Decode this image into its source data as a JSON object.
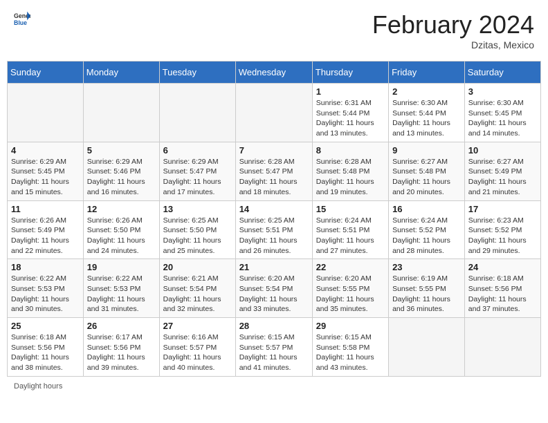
{
  "header": {
    "logo_general": "General",
    "logo_blue": "Blue",
    "month_title": "February 2024",
    "subtitle": "Dzitas, Mexico"
  },
  "days_of_week": [
    "Sunday",
    "Monday",
    "Tuesday",
    "Wednesday",
    "Thursday",
    "Friday",
    "Saturday"
  ],
  "weeks": [
    [
      {
        "day": "",
        "info": ""
      },
      {
        "day": "",
        "info": ""
      },
      {
        "day": "",
        "info": ""
      },
      {
        "day": "",
        "info": ""
      },
      {
        "day": "1",
        "info": "Sunrise: 6:31 AM\nSunset: 5:44 PM\nDaylight: 11 hours and 13 minutes."
      },
      {
        "day": "2",
        "info": "Sunrise: 6:30 AM\nSunset: 5:44 PM\nDaylight: 11 hours and 13 minutes."
      },
      {
        "day": "3",
        "info": "Sunrise: 6:30 AM\nSunset: 5:45 PM\nDaylight: 11 hours and 14 minutes."
      }
    ],
    [
      {
        "day": "4",
        "info": "Sunrise: 6:29 AM\nSunset: 5:45 PM\nDaylight: 11 hours and 15 minutes."
      },
      {
        "day": "5",
        "info": "Sunrise: 6:29 AM\nSunset: 5:46 PM\nDaylight: 11 hours and 16 minutes."
      },
      {
        "day": "6",
        "info": "Sunrise: 6:29 AM\nSunset: 5:47 PM\nDaylight: 11 hours and 17 minutes."
      },
      {
        "day": "7",
        "info": "Sunrise: 6:28 AM\nSunset: 5:47 PM\nDaylight: 11 hours and 18 minutes."
      },
      {
        "day": "8",
        "info": "Sunrise: 6:28 AM\nSunset: 5:48 PM\nDaylight: 11 hours and 19 minutes."
      },
      {
        "day": "9",
        "info": "Sunrise: 6:27 AM\nSunset: 5:48 PM\nDaylight: 11 hours and 20 minutes."
      },
      {
        "day": "10",
        "info": "Sunrise: 6:27 AM\nSunset: 5:49 PM\nDaylight: 11 hours and 21 minutes."
      }
    ],
    [
      {
        "day": "11",
        "info": "Sunrise: 6:26 AM\nSunset: 5:49 PM\nDaylight: 11 hours and 22 minutes."
      },
      {
        "day": "12",
        "info": "Sunrise: 6:26 AM\nSunset: 5:50 PM\nDaylight: 11 hours and 24 minutes."
      },
      {
        "day": "13",
        "info": "Sunrise: 6:25 AM\nSunset: 5:50 PM\nDaylight: 11 hours and 25 minutes."
      },
      {
        "day": "14",
        "info": "Sunrise: 6:25 AM\nSunset: 5:51 PM\nDaylight: 11 hours and 26 minutes."
      },
      {
        "day": "15",
        "info": "Sunrise: 6:24 AM\nSunset: 5:51 PM\nDaylight: 11 hours and 27 minutes."
      },
      {
        "day": "16",
        "info": "Sunrise: 6:24 AM\nSunset: 5:52 PM\nDaylight: 11 hours and 28 minutes."
      },
      {
        "day": "17",
        "info": "Sunrise: 6:23 AM\nSunset: 5:52 PM\nDaylight: 11 hours and 29 minutes."
      }
    ],
    [
      {
        "day": "18",
        "info": "Sunrise: 6:22 AM\nSunset: 5:53 PM\nDaylight: 11 hours and 30 minutes."
      },
      {
        "day": "19",
        "info": "Sunrise: 6:22 AM\nSunset: 5:53 PM\nDaylight: 11 hours and 31 minutes."
      },
      {
        "day": "20",
        "info": "Sunrise: 6:21 AM\nSunset: 5:54 PM\nDaylight: 11 hours and 32 minutes."
      },
      {
        "day": "21",
        "info": "Sunrise: 6:20 AM\nSunset: 5:54 PM\nDaylight: 11 hours and 33 minutes."
      },
      {
        "day": "22",
        "info": "Sunrise: 6:20 AM\nSunset: 5:55 PM\nDaylight: 11 hours and 35 minutes."
      },
      {
        "day": "23",
        "info": "Sunrise: 6:19 AM\nSunset: 5:55 PM\nDaylight: 11 hours and 36 minutes."
      },
      {
        "day": "24",
        "info": "Sunrise: 6:18 AM\nSunset: 5:56 PM\nDaylight: 11 hours and 37 minutes."
      }
    ],
    [
      {
        "day": "25",
        "info": "Sunrise: 6:18 AM\nSunset: 5:56 PM\nDaylight: 11 hours and 38 minutes."
      },
      {
        "day": "26",
        "info": "Sunrise: 6:17 AM\nSunset: 5:56 PM\nDaylight: 11 hours and 39 minutes."
      },
      {
        "day": "27",
        "info": "Sunrise: 6:16 AM\nSunset: 5:57 PM\nDaylight: 11 hours and 40 minutes."
      },
      {
        "day": "28",
        "info": "Sunrise: 6:15 AM\nSunset: 5:57 PM\nDaylight: 11 hours and 41 minutes."
      },
      {
        "day": "29",
        "info": "Sunrise: 6:15 AM\nSunset: 5:58 PM\nDaylight: 11 hours and 43 minutes."
      },
      {
        "day": "",
        "info": ""
      },
      {
        "day": "",
        "info": ""
      }
    ]
  ],
  "footer": {
    "daylight_label": "Daylight hours"
  }
}
